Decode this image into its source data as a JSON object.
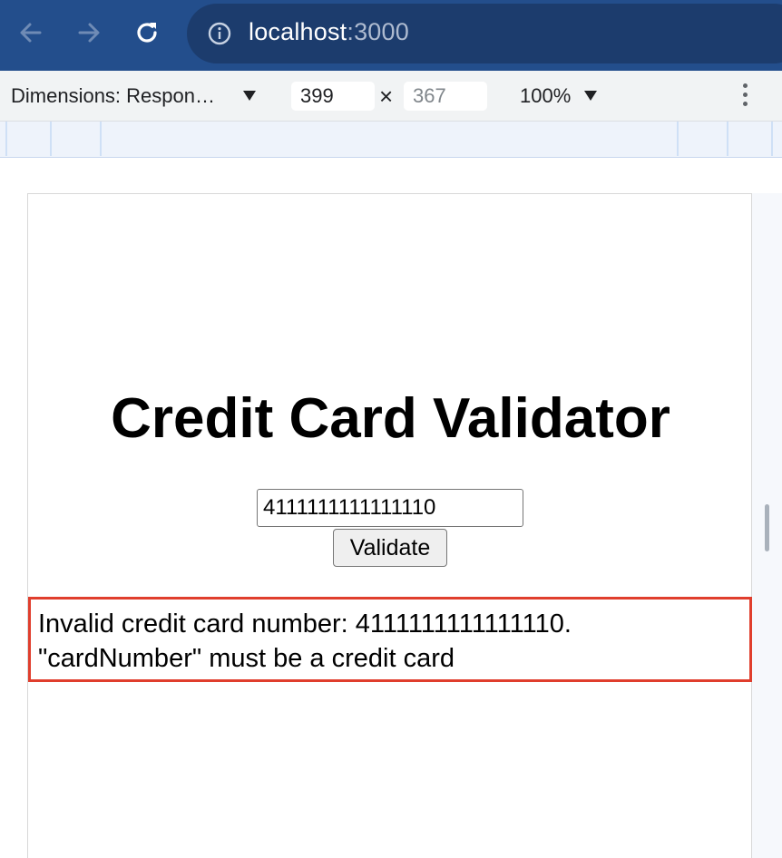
{
  "browser": {
    "url_host": "localhost",
    "url_port": ":3000"
  },
  "devtools": {
    "dimensions_label": "Dimensions: Respon…",
    "width": "399",
    "height": "367",
    "times": "×",
    "zoom": "100%"
  },
  "page": {
    "title": "Credit Card Validator",
    "card_input_value": "4111111111111110",
    "validate_label": "Validate",
    "error_line1": "Invalid credit card number: 4111111111111110.",
    "error_line2": "\"cardNumber\" must be a credit card"
  },
  "colors": {
    "browser_bar": "#234e8c",
    "error_border": "#e03e2d"
  }
}
